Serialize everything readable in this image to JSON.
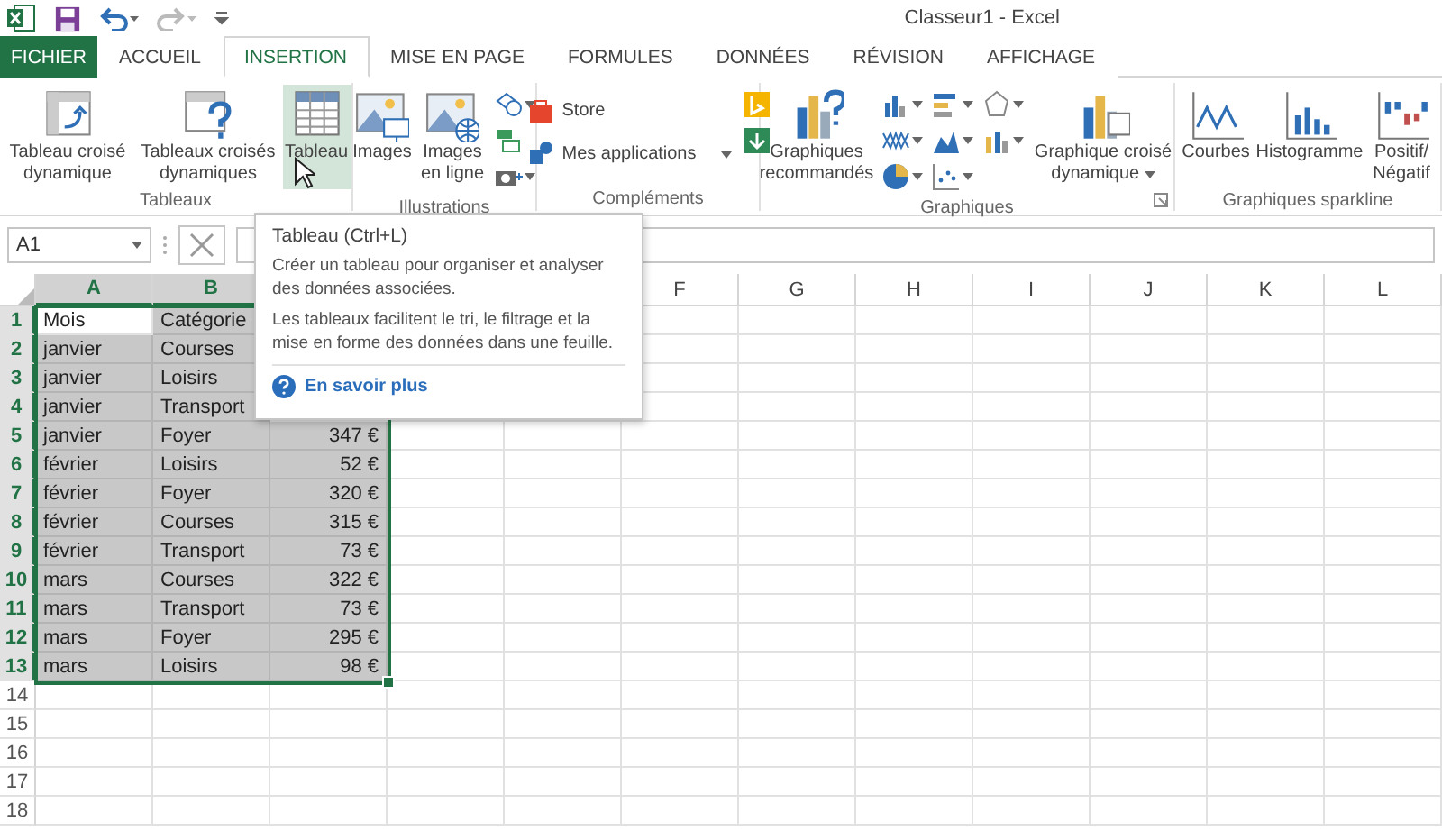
{
  "title_bar": {
    "title": "Classeur1 - Excel"
  },
  "tabs": [
    {
      "label": "FICHIER",
      "kind": "file",
      "selected": false
    },
    {
      "label": "ACCUEIL",
      "kind": "tab",
      "selected": false
    },
    {
      "label": "INSERTION",
      "kind": "tab",
      "selected": true
    },
    {
      "label": "MISE EN PAGE",
      "kind": "tab",
      "selected": false
    },
    {
      "label": "FORMULES",
      "kind": "tab",
      "selected": false
    },
    {
      "label": "DONNÉES",
      "kind": "tab",
      "selected": false
    },
    {
      "label": "RÉVISION",
      "kind": "tab",
      "selected": false
    },
    {
      "label": "AFFICHAGE",
      "kind": "tab",
      "selected": false
    }
  ],
  "ribbon": {
    "groups": [
      {
        "label": "Tableaux",
        "items": [
          {
            "kind": "large",
            "label": "Tableau croisé dynamique",
            "highlighted": false
          },
          {
            "kind": "large",
            "label": "Tableaux croisés dynamiques",
            "highlighted": false
          },
          {
            "kind": "large",
            "label": "Tableau",
            "highlighted": true
          }
        ]
      },
      {
        "label": "Illustrations",
        "items": [
          {
            "kind": "large",
            "label": "Images",
            "highlighted": false
          },
          {
            "kind": "large",
            "label": "Images en ligne",
            "highlighted": false
          },
          {
            "kind": "icons"
          }
        ]
      },
      {
        "label": "Compléments",
        "items": [
          {
            "kind": "stack",
            "entries": [
              {
                "label": "Store",
                "dropdown": false
              },
              {
                "label": "Mes applications",
                "dropdown": true
              }
            ]
          },
          {
            "kind": "icons"
          }
        ]
      },
      {
        "label": "Graphiques",
        "launcher": true,
        "items": [
          {
            "kind": "large",
            "label": "Graphiques recommandés",
            "highlighted": false
          },
          {
            "kind": "icons"
          },
          {
            "kind": "large",
            "label": "Graphique croisé dynamique",
            "highlighted": false,
            "dropdown": true
          }
        ]
      },
      {
        "label": "Graphiques sparkline",
        "items": [
          {
            "kind": "large",
            "label": "Courbes",
            "highlighted": false
          },
          {
            "kind": "large",
            "label": "Histogramme",
            "highlighted": false
          },
          {
            "kind": "large",
            "label": "Positif/Négatif",
            "highlighted": false
          }
        ]
      }
    ]
  },
  "formula_bar": {
    "name_box": "A1"
  },
  "tooltip": {
    "title": "Tableau (Ctrl+L)",
    "paragraphs": [
      "Créer un tableau pour organiser et analyser des données associées.",
      "Les tableaux facilitent le tri, le filtrage et la mise en forme des données dans une feuille."
    ],
    "link": "En savoir plus"
  },
  "sheet": {
    "columns": [
      {
        "label": "A",
        "selected": true
      },
      {
        "label": "B",
        "selected": true
      },
      {
        "label": "F",
        "selected": false
      },
      {
        "label": "G",
        "selected": false
      },
      {
        "label": "H",
        "selected": false
      },
      {
        "label": "I",
        "selected": false
      },
      {
        "label": "J",
        "selected": false
      },
      {
        "label": "K",
        "selected": false
      },
      {
        "label": "L",
        "selected": false
      }
    ],
    "rows": [
      {
        "label": "1",
        "selected": true,
        "cells": [
          {
            "text": "Mois",
            "active": true
          },
          {
            "text": "Catégorie",
            "active": false
          }
        ]
      },
      {
        "label": "2",
        "selected": true,
        "cells": [
          {
            "text": "janvier",
            "active": false
          },
          {
            "text": "Courses",
            "active": false
          }
        ]
      },
      {
        "label": "3",
        "selected": true,
        "cells": [
          {
            "text": "janvier",
            "active": false
          },
          {
            "text": "Loisirs",
            "active": false
          }
        ]
      },
      {
        "label": "4",
        "selected": true,
        "cells": [
          {
            "text": "janvier",
            "active": false
          },
          {
            "text": "Transport",
            "active": false
          }
        ]
      },
      {
        "label": "5",
        "selected": true,
        "cells": [
          {
            "text": "janvier",
            "active": false
          },
          {
            "text": "Foyer",
            "active": false
          },
          {
            "text": "347 €",
            "active": false
          }
        ]
      },
      {
        "label": "6",
        "selected": true,
        "cells": [
          {
            "text": "février",
            "active": false
          },
          {
            "text": "Loisirs",
            "active": false
          },
          {
            "text": "52 €",
            "active": false
          }
        ]
      },
      {
        "label": "7",
        "selected": true,
        "cells": [
          {
            "text": "février",
            "active": false
          },
          {
            "text": "Foyer",
            "active": false
          },
          {
            "text": "320 €",
            "active": false
          }
        ]
      },
      {
        "label": "8",
        "selected": true,
        "cells": [
          {
            "text": "février",
            "active": false
          },
          {
            "text": "Courses",
            "active": false
          },
          {
            "text": "315 €",
            "active": false
          }
        ]
      },
      {
        "label": "9",
        "selected": true,
        "cells": [
          {
            "text": "février",
            "active": false
          },
          {
            "text": "Transport",
            "active": false
          },
          {
            "text": "73 €",
            "active": false
          }
        ]
      },
      {
        "label": "10",
        "selected": true,
        "cells": [
          {
            "text": "mars",
            "active": false
          },
          {
            "text": "Courses",
            "active": false
          },
          {
            "text": "322 €",
            "active": false
          }
        ]
      },
      {
        "label": "11",
        "selected": true,
        "cells": [
          {
            "text": "mars",
            "active": false
          },
          {
            "text": "Transport",
            "active": false
          },
          {
            "text": "73 €",
            "active": false
          }
        ]
      },
      {
        "label": "12",
        "selected": true,
        "cells": [
          {
            "text": "mars",
            "active": false
          },
          {
            "text": "Foyer",
            "active": false
          },
          {
            "text": "295 €",
            "active": false
          }
        ]
      },
      {
        "label": "13",
        "selected": true,
        "cells": [
          {
            "text": "mars",
            "active": false
          },
          {
            "text": "Loisirs",
            "active": false
          },
          {
            "text": "98 €",
            "active": false
          }
        ]
      },
      {
        "label": "14",
        "selected": false,
        "cells": []
      },
      {
        "label": "15",
        "selected": false,
        "cells": []
      },
      {
        "label": "16",
        "selected": false,
        "cells": []
      },
      {
        "label": "17",
        "selected": false,
        "cells": []
      },
      {
        "label": "18",
        "selected": false,
        "cells": []
      }
    ]
  }
}
